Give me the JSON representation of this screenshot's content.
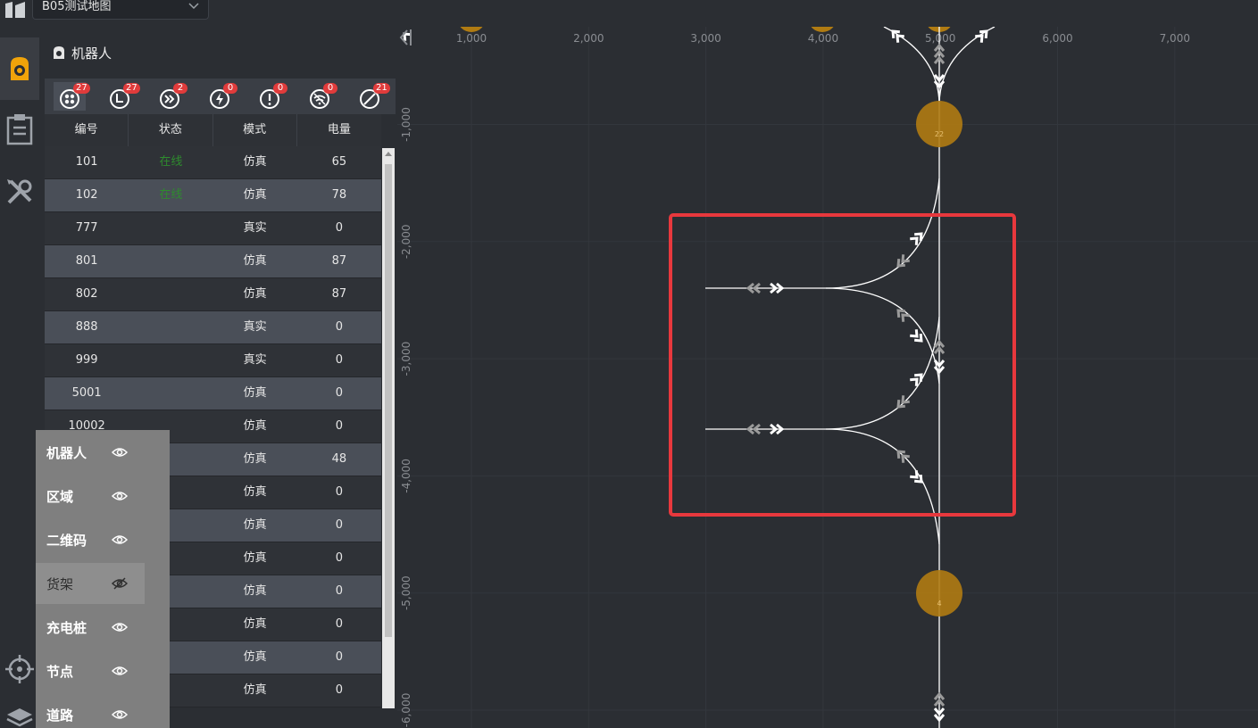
{
  "header": {
    "map_name": "B05测试地图"
  },
  "nav": {
    "robot_icon": "robot-icon",
    "task_icon": "clipboard-icon",
    "tools_icon": "tools-icon",
    "locate_icon": "crosshair-icon",
    "layers_icon": "layers-icon",
    "active_color": "#f0a30a"
  },
  "panel": {
    "title": "机器人",
    "filters": [
      {
        "icon": "all-robots-icon",
        "count": "27"
      },
      {
        "icon": "clock-icon",
        "count": "27"
      },
      {
        "icon": "fast-forward-icon",
        "count": "2"
      },
      {
        "icon": "charging-icon",
        "count": "0"
      },
      {
        "icon": "error-icon",
        "count": "0"
      },
      {
        "icon": "offline-icon",
        "count": "0"
      },
      {
        "icon": "disabled-icon",
        "count": "21"
      }
    ],
    "columns": [
      "编号",
      "状态",
      "模式",
      "电量"
    ],
    "rows": [
      [
        "101",
        "在线",
        "仿真",
        "65"
      ],
      [
        "102",
        "在线",
        "仿真",
        "78"
      ],
      [
        "777",
        "",
        "真实",
        "0"
      ],
      [
        "801",
        "",
        "仿真",
        "87"
      ],
      [
        "802",
        "",
        "仿真",
        "87"
      ],
      [
        "888",
        "",
        "真实",
        "0"
      ],
      [
        "999",
        "",
        "真实",
        "0"
      ],
      [
        "5001",
        "",
        "仿真",
        "0"
      ],
      [
        "10002",
        "",
        "仿真",
        "0"
      ],
      [
        "",
        "",
        "仿真",
        "48"
      ],
      [
        "",
        "",
        "仿真",
        "0"
      ],
      [
        "",
        "",
        "仿真",
        "0"
      ],
      [
        "",
        "",
        "仿真",
        "0"
      ],
      [
        "",
        "",
        "仿真",
        "0"
      ],
      [
        "",
        "",
        "仿真",
        "0"
      ],
      [
        "",
        "",
        "仿真",
        "0"
      ],
      [
        "",
        "",
        "仿真",
        "0"
      ]
    ]
  },
  "layers": [
    {
      "label": "机器人",
      "visible": true
    },
    {
      "label": "区域",
      "visible": true
    },
    {
      "label": "二维码",
      "visible": true
    },
    {
      "label": "货架",
      "visible": false
    },
    {
      "label": "充电桩",
      "visible": true
    },
    {
      "label": "节点",
      "visible": true
    },
    {
      "label": "道路",
      "visible": true
    }
  ],
  "map": {
    "x_ticks": [
      "1,000",
      "2,000",
      "3,000",
      "4,000",
      "5,000",
      "6,000",
      "7,000"
    ],
    "y_ticks": [
      "-1,000",
      "-2,000",
      "-3,000",
      "-4,000",
      "-5,000",
      "-6,000"
    ],
    "nodes": [
      {
        "label": "22"
      },
      {
        "label": "4"
      }
    ],
    "node_color": "#b07b12",
    "highlight_color": "#e8383d"
  }
}
